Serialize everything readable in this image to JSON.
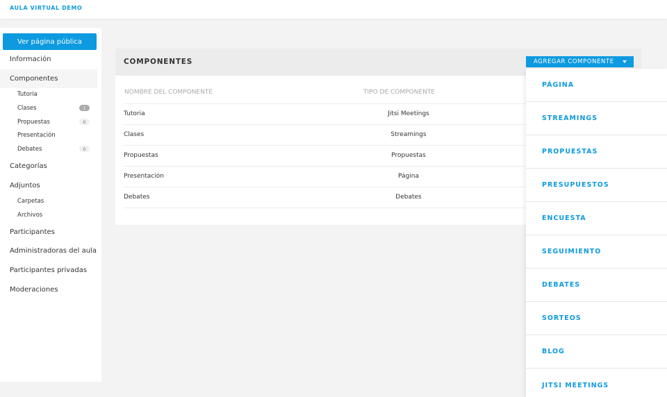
{
  "header": {
    "brand": "AULA VIRTUAL DEMO"
  },
  "sidebar": {
    "public_button": "Ver página pública",
    "items": [
      {
        "label": "Información"
      },
      {
        "label": "Componentes",
        "active": true
      },
      {
        "label": "Tutoria",
        "sub": true
      },
      {
        "label": "Clases",
        "sub": true,
        "badge": "1"
      },
      {
        "label": "Propuestas",
        "sub": true,
        "badge": "0"
      },
      {
        "label": "Presentación",
        "sub": true
      },
      {
        "label": "Debates",
        "sub": true,
        "badge": "0"
      },
      {
        "label": "Categorías"
      },
      {
        "label": "Adjuntos"
      },
      {
        "label": "Carpetas",
        "sub": true
      },
      {
        "label": "Archivos",
        "sub": true
      },
      {
        "label": "Participantes"
      },
      {
        "label": "Administradoras del aula"
      },
      {
        "label": "Participantes privadas"
      },
      {
        "label": "Moderaciones"
      }
    ]
  },
  "panel": {
    "title": "COMPONENTES",
    "add_button": "AGREGAR COMPONENTE",
    "columns": [
      "NOMBRE DEL COMPONENTE",
      "TIPO DE COMPONENTE"
    ],
    "rows": [
      {
        "name": "Tutoria",
        "type": "Jitsi Meetings"
      },
      {
        "name": "Clases",
        "type": "Streamings"
      },
      {
        "name": "Propuestas",
        "type": "Propuestas"
      },
      {
        "name": "Presentación",
        "type": "Página"
      },
      {
        "name": "Debates",
        "type": "Debates"
      }
    ]
  },
  "dropdown": {
    "options": [
      "PÁGINA",
      "STREAMINGS",
      "PROPUESTAS",
      "PRESUPUESTOS",
      "ENCUESTA",
      "SEGUIMIENTO",
      "DEBATES",
      "SORTEOS",
      "BLOG",
      "JITSI MEETINGS"
    ]
  },
  "colors": {
    "accent": "#0d9ae0",
    "background": "#f3f3f3"
  }
}
